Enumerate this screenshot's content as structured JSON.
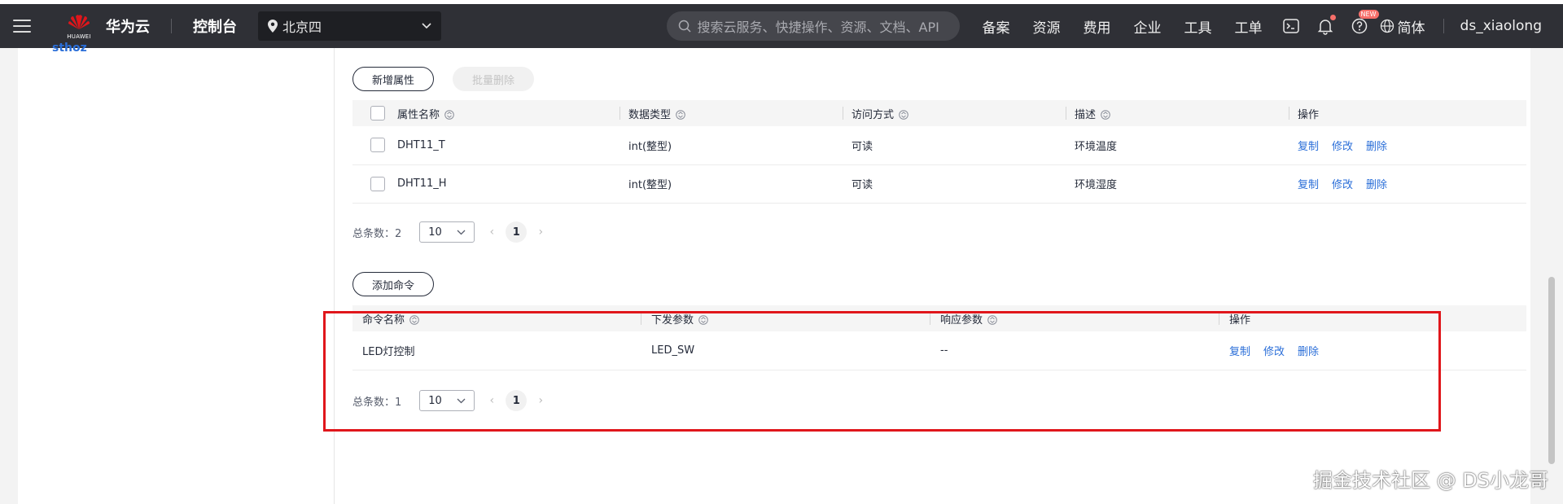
{
  "header": {
    "logo_text": "HUAWEI",
    "brand": "华为云",
    "console": "控制台",
    "region": "北京四",
    "search_placeholder": "搜索云服务、快捷操作、资源、文档、API",
    "nav_links": [
      "备案",
      "资源",
      "费用",
      "企业",
      "工具",
      "工单"
    ],
    "new_badge": "NEW",
    "language": "简体",
    "username": "ds_xiaolong"
  },
  "sidebar": {
    "link_text": "sthoz"
  },
  "properties": {
    "add_button": "新增属性",
    "batch_delete_button": "批量删除",
    "columns": [
      "属性名称",
      "数据类型",
      "访问方式",
      "描述",
      "操作"
    ],
    "rows": [
      {
        "name": "DHT11_T",
        "type": "int(整型)",
        "access": "可读",
        "desc": "环境温度"
      },
      {
        "name": "DHT11_H",
        "type": "int(整型)",
        "access": "可读",
        "desc": "环境湿度"
      }
    ],
    "actions": [
      "复制",
      "修改",
      "删除"
    ],
    "total_label": "总条数：2",
    "page_size": "10",
    "current_page": "1"
  },
  "commands": {
    "add_button": "添加命令",
    "columns": [
      "命令名称",
      "下发参数",
      "响应参数",
      "操作"
    ],
    "rows": [
      {
        "name": "LED灯控制",
        "send_params": "LED_SW",
        "response_params": "--"
      }
    ],
    "actions": [
      "复制",
      "修改",
      "删除"
    ],
    "total_label": "总条数：1",
    "page_size": "10",
    "current_page": "1"
  },
  "watermark": "掘金技术社区 @ DS小龙哥",
  "colors": {
    "topbar": "#2f3036",
    "link": "#2a6ed8",
    "highlight": "#e0161b"
  }
}
